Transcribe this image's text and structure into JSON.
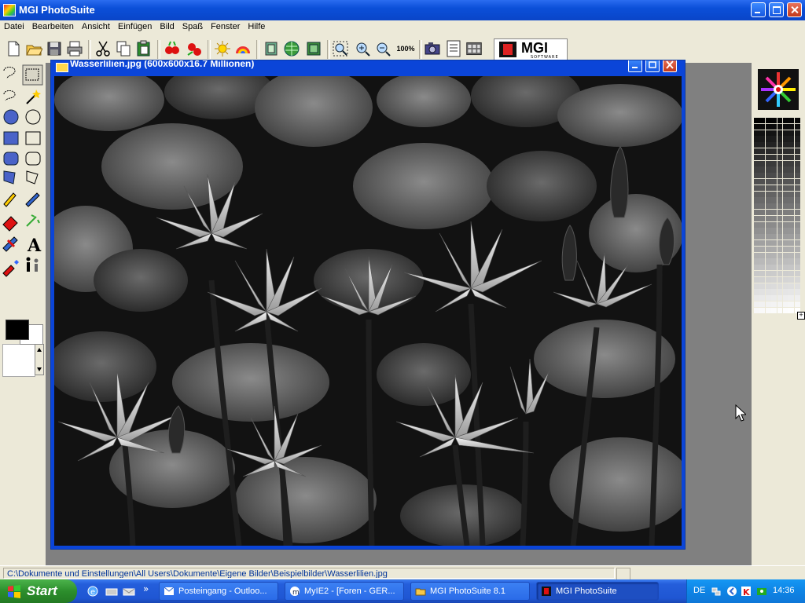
{
  "app": {
    "title": "MGI PhotoSuite"
  },
  "menu": [
    "Datei",
    "Bearbeiten",
    "Ansicht",
    "Einfügen",
    "Bild",
    "Spaß",
    "Fenster",
    "Hilfe"
  ],
  "toolbar": {
    "icons": [
      "new-file-icon",
      "open-folder-icon",
      "save-icon",
      "print-icon",
      "cut-icon",
      "copy-icon",
      "paste-icon",
      "red-eye-icon",
      "fix-icon",
      "brightness-icon",
      "color-adjust-icon",
      "crop-icon",
      "globe-icon",
      "photo-icon",
      "zoom-select-icon",
      "zoom-in-icon",
      "zoom-out-icon",
      "zoom-100-icon",
      "camera-icon",
      "scan-icon",
      "album-icon"
    ],
    "zoom_100_label": "100%",
    "logo_text": "MGI",
    "logo_sub": "SOFTWARE"
  },
  "document": {
    "title": "Wasserlilien.jpg (600x600x16.7 Millionen)",
    "image_subject": "black-and-white photograph of water lilies and lily pads"
  },
  "status": {
    "path": "C:\\Dokumente und Einstellungen\\All Users\\Dokumente\\Eigene Bilder\\Beispielbilder\\Wasserlilien.jpg"
  },
  "taskbar": {
    "start_label": "Start",
    "tasks": [
      {
        "label": "Posteingang - Outloo...",
        "icon": "outlook-icon",
        "active": false
      },
      {
        "label": "MyIE2 - [Foren - GER...",
        "icon": "browser-icon",
        "active": false
      },
      {
        "label": "MGI PhotoSuite 8.1",
        "icon": "folder-icon",
        "active": false
      },
      {
        "label": "MGI PhotoSuite",
        "icon": "photosuite-icon",
        "active": true
      }
    ],
    "language": "DE",
    "clock": "14:36"
  },
  "colors": {
    "foreground": "#000000",
    "background": "#ffffff",
    "title_blue": "#0b4fd8",
    "taskbar_blue": "#245edb"
  }
}
